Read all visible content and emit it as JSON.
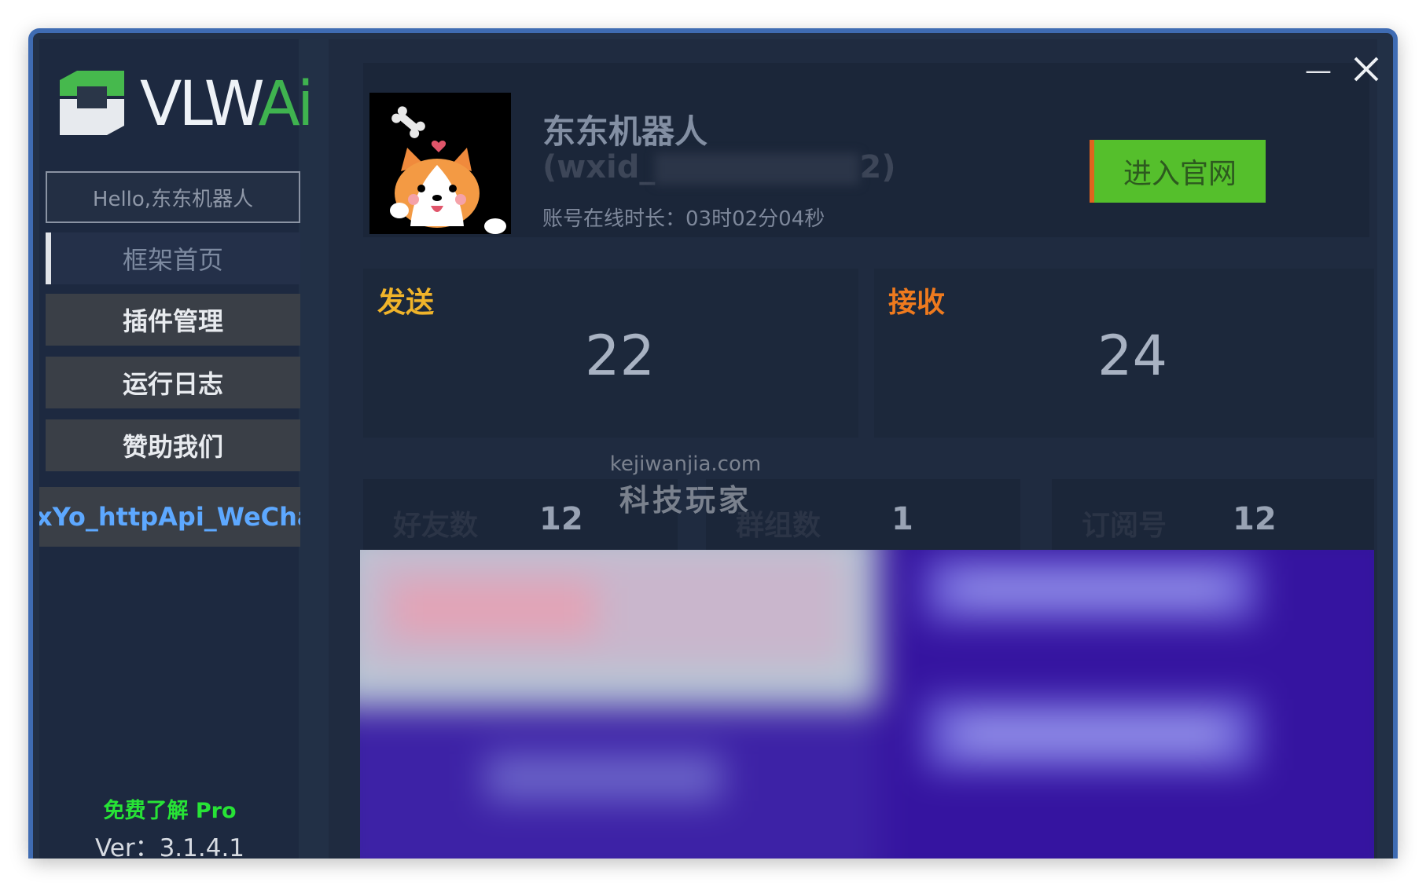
{
  "app": {
    "logo_text": "VLW",
    "logo_text_accent": "Ai",
    "colors": {
      "window_border": "#3f6cb3",
      "background": "#223046",
      "accent_green": "#55bf2c",
      "send_label": "#f0b42a",
      "receive_label": "#ee7a1e",
      "pro_link": "#27e336",
      "plugin_link": "#5da8ff"
    }
  },
  "window_controls": {
    "minimize_icon": "minimize-icon",
    "close_icon": "close-icon"
  },
  "sidebar": {
    "greeting": "Hello,东东机器人",
    "items": [
      {
        "label": "框架首页",
        "active": true
      },
      {
        "label": "插件管理",
        "active": false
      },
      {
        "label": "运行日志",
        "active": false
      },
      {
        "label": "赞助我们",
        "active": false
      }
    ],
    "plugin_label": "xYo_httpApi_WeChat",
    "pro_link": "免费了解 Pro",
    "version": "Ver：3.1.4.1"
  },
  "profile": {
    "nickname": "东东机器人",
    "wxid_prefix": "(wxid_",
    "wxid_suffix": "2)",
    "online_time": "账号在线时长：03时02分04秒",
    "official_button": "进入官网"
  },
  "stats": {
    "send_label": "发送",
    "send_value": "22",
    "receive_label": "接收",
    "receive_value": "24"
  },
  "counts": [
    {
      "label": "好友数",
      "value": "12"
    },
    {
      "label": "群组数",
      "value": "1"
    },
    {
      "label": "订阅号",
      "value": "12"
    }
  ],
  "watermark": {
    "line1": "kejiwanjia.com",
    "line2": "科技玩家"
  }
}
